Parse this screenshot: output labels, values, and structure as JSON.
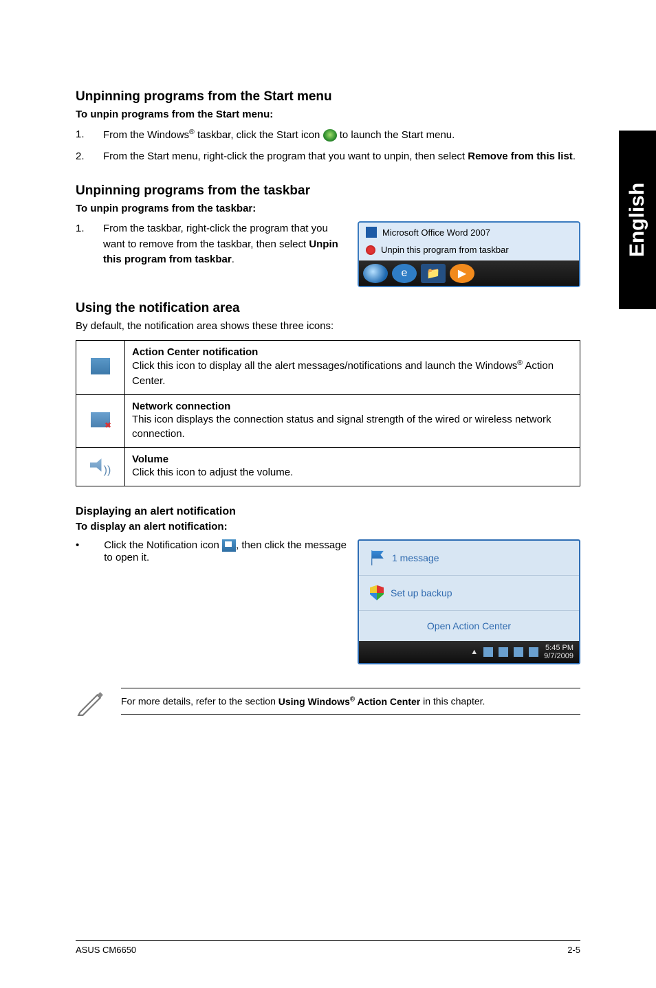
{
  "side_tab": "English",
  "sec1": {
    "heading": "Unpinning programs from the Start menu",
    "sub": "To unpin programs from the Start menu:",
    "step1_pre": "From the Windows",
    "step1_post": " taskbar, click the Start icon ",
    "step1_tail": " to launch the Start menu.",
    "step2_a": "From the Start menu, right-click the program that you want to unpin, then select ",
    "step2_b": "Remove from this list",
    "step2_c": "."
  },
  "sec2": {
    "heading": "Unpinning programs from the taskbar",
    "sub": "To unpin programs from the taskbar:",
    "step1_a": "From the taskbar, right-click the program that you want to remove from the taskbar, then select ",
    "step1_b": "Unpin this program from taskbar",
    "step1_c": ".",
    "popup_line1": "Microsoft Office Word 2007",
    "popup_line2": "Unpin this program from taskbar"
  },
  "sec3": {
    "heading": "Using the notification area",
    "lead": "By default, the notification area shows these three icons:",
    "rows": [
      {
        "title": "Action Center notification",
        "body_a": "Click this icon to display all the alert messages/notifications and launch the Windows",
        "body_b": " Action Center."
      },
      {
        "title": "Network connection",
        "body": "This icon displays the connection status and signal strength of the wired or wireless network connection."
      },
      {
        "title": "Volume",
        "body": "Click this icon to adjust the volume."
      }
    ]
  },
  "sec4": {
    "heading": "Displaying an alert notification",
    "sub": "To display an alert notification:",
    "bullet_a": "Click the Notification icon ",
    "bullet_b": ", then click the message to open it.",
    "alert_msg": "1 message",
    "alert_setup": "Set up backup",
    "alert_open": "Open Action Center",
    "tray_time": "5:45 PM",
    "tray_date": "9/7/2009"
  },
  "note": {
    "text_a": "For more details, refer to the section ",
    "text_b": "Using Windows",
    "text_c": " Action Center",
    "text_d": " in this chapter."
  },
  "footer": {
    "left": "ASUS CM6650",
    "right": "2-5"
  }
}
